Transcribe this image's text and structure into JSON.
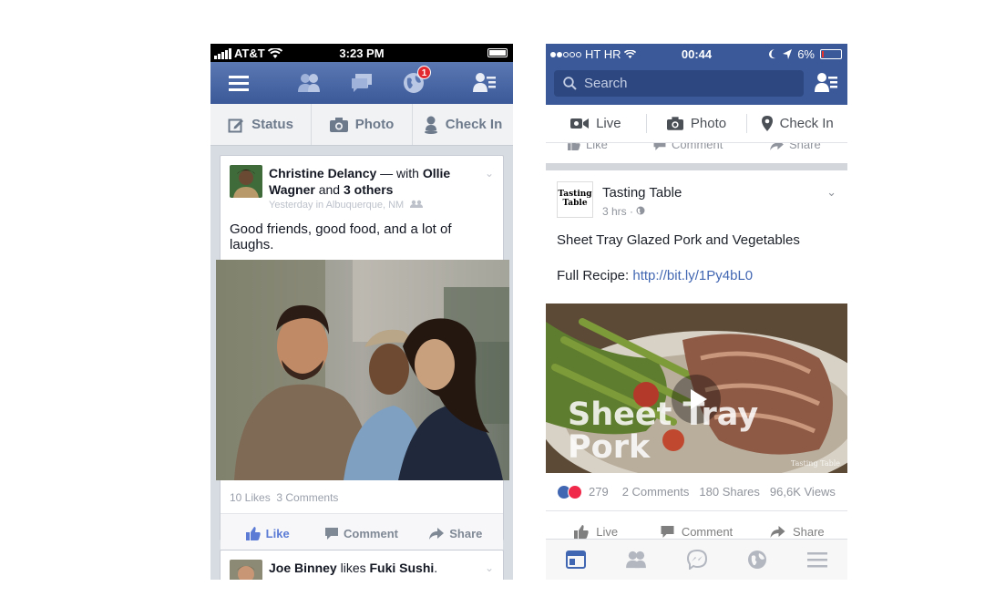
{
  "left_phone": {
    "status_bar": {
      "carrier": "AT&T",
      "time": "3:23 PM"
    },
    "nav": {
      "notification_count": "1",
      "icons": [
        "menu-icon",
        "friends-icon",
        "messages-icon",
        "globe-icon",
        "friend-requests-icon"
      ]
    },
    "composer": {
      "status_label": "Status",
      "photo_label": "Photo",
      "checkin_label": "Check In"
    },
    "post": {
      "author": "Christine Delancy",
      "with_text": " — with ",
      "tagged1": "Ollie Wagner",
      "and_text": " and ",
      "tagged2": "3 others",
      "meta": "Yesterday in Albuquerque, NM",
      "message": "Good friends, good food, and a lot of laughs.",
      "likes": "10 Likes",
      "comments": "3 Comments",
      "like_label": "Like",
      "comment_label": "Comment",
      "share_label": "Share"
    },
    "next_post": {
      "author": "Joe Binney",
      "verb": " likes ",
      "page": "Fuki Sushi",
      "end": "."
    }
  },
  "right_phone": {
    "status_bar": {
      "carrier": "HT HR",
      "time": "00:44",
      "battery": "6%"
    },
    "search": {
      "placeholder": "Search"
    },
    "composer": {
      "live_label": "Live",
      "photo_label": "Photo",
      "checkin_label": "Check In"
    },
    "prev_actions": {
      "like": "Like",
      "comment": "Comment",
      "share": "Share"
    },
    "post": {
      "page_name": "Tasting Table",
      "logo_text": "Tasting Table",
      "time": "3 hrs · ",
      "message": "Sheet Tray Glazed Pork and Vegetables",
      "recipe_prefix": "Full Recipe: ",
      "recipe_link": "http://bit.ly/1Py4bL0",
      "video_title_line1": "Sheet Tray",
      "video_title_line2": "Pork",
      "video_logo": "Tasting Table",
      "reactions": "279",
      "comments": "2 Comments",
      "shares": "180 Shares",
      "views": "96,6K Views",
      "like_label": "Live",
      "comment_label": "Comment",
      "share_label": "Share"
    },
    "tabs": [
      "news-feed-icon",
      "friends-icon",
      "messenger-icon",
      "globe-icon",
      "menu-icon"
    ],
    "colors": {
      "brand": "#3b5998",
      "link": "#4267b2",
      "active_tab": "#4267b2",
      "inactive_tab": "#b3b7bf"
    }
  }
}
